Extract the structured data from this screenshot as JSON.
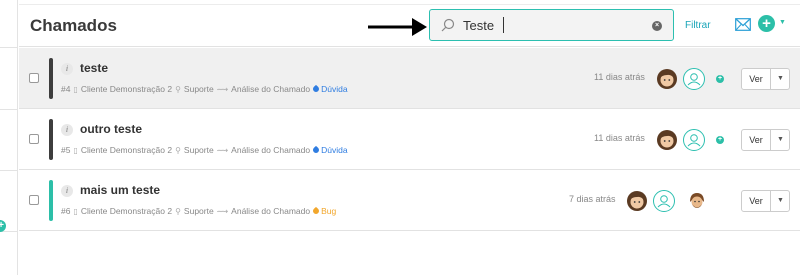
{
  "header": {
    "title": "Chamados",
    "search": {
      "value": "Teste",
      "placeholder": ""
    },
    "filter_label": "Filtrar"
  },
  "tickets": [
    {
      "title": "teste",
      "number": "#4",
      "client": "Cliente Demonstração 2",
      "department": "Suporte",
      "status": "Análise do Chamado",
      "tag": "Dúvida",
      "time": "11 dias atrás",
      "action": "Ver"
    },
    {
      "title": "outro teste",
      "number": "#5",
      "client": "Cliente Demonstração 2",
      "department": "Suporte",
      "status": "Análise do Chamado",
      "tag": "Dúvida",
      "time": "11 dias atrás",
      "action": "Ver"
    },
    {
      "title": "mais um teste",
      "number": "#6",
      "client": "Cliente Demonstração 2",
      "department": "Suporte",
      "status": "Análise do Chamado",
      "tag": "Bug",
      "time": "7 dias atrás",
      "action": "Ver"
    }
  ],
  "colors": {
    "accent": "#2cbfa8",
    "bar_dark": "#3d3d3d",
    "bar_teal": "#2cbfa8",
    "tag_duvida": "#2f7de1",
    "tag_bug": "#f2a72c",
    "link": "#1aa5b8"
  },
  "icons": [
    "search-icon",
    "clear-icon",
    "mail-icon",
    "add-icon",
    "chevron-down-icon",
    "info-icon",
    "building-icon",
    "location-icon",
    "flow-icon",
    "tag-icon",
    "user-icon"
  ]
}
